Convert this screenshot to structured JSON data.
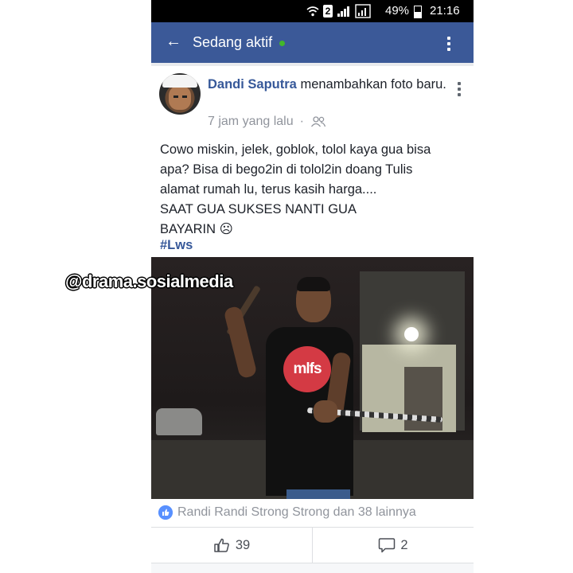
{
  "status_bar": {
    "sim_badge": "2",
    "battery": "49%",
    "time": "21:16"
  },
  "app_bar": {
    "title": "Sedang aktif",
    "back_icon": "arrow-left",
    "online_color": "#42b72a",
    "background": "#3b5998"
  },
  "post": {
    "author": "Dandi Saputra",
    "action": " menambahkan foto baru.",
    "time": "7 jam yang lalu",
    "separator": "·",
    "privacy_icon": "friends-icon",
    "text_lines": [
      "Cowo miskin, jelek, goblok, tolol kaya gua bisa",
      "apa? Bisa di bego2in di tolol2in doang Tulis",
      "alamat rumah lu, terus kasih harga....",
      "SAAT GUA SUKSES NANTI GUA",
      "BAYARIN"
    ],
    "emoji": "☹",
    "hashtag": "#Lws",
    "shirt_logo": "mlfs"
  },
  "watermark": "@drama.sosialmedia",
  "reactions": {
    "text": "Randi Randi Strong Strong dan 38 lainnya",
    "like_count": "39",
    "comment_count": "2"
  }
}
